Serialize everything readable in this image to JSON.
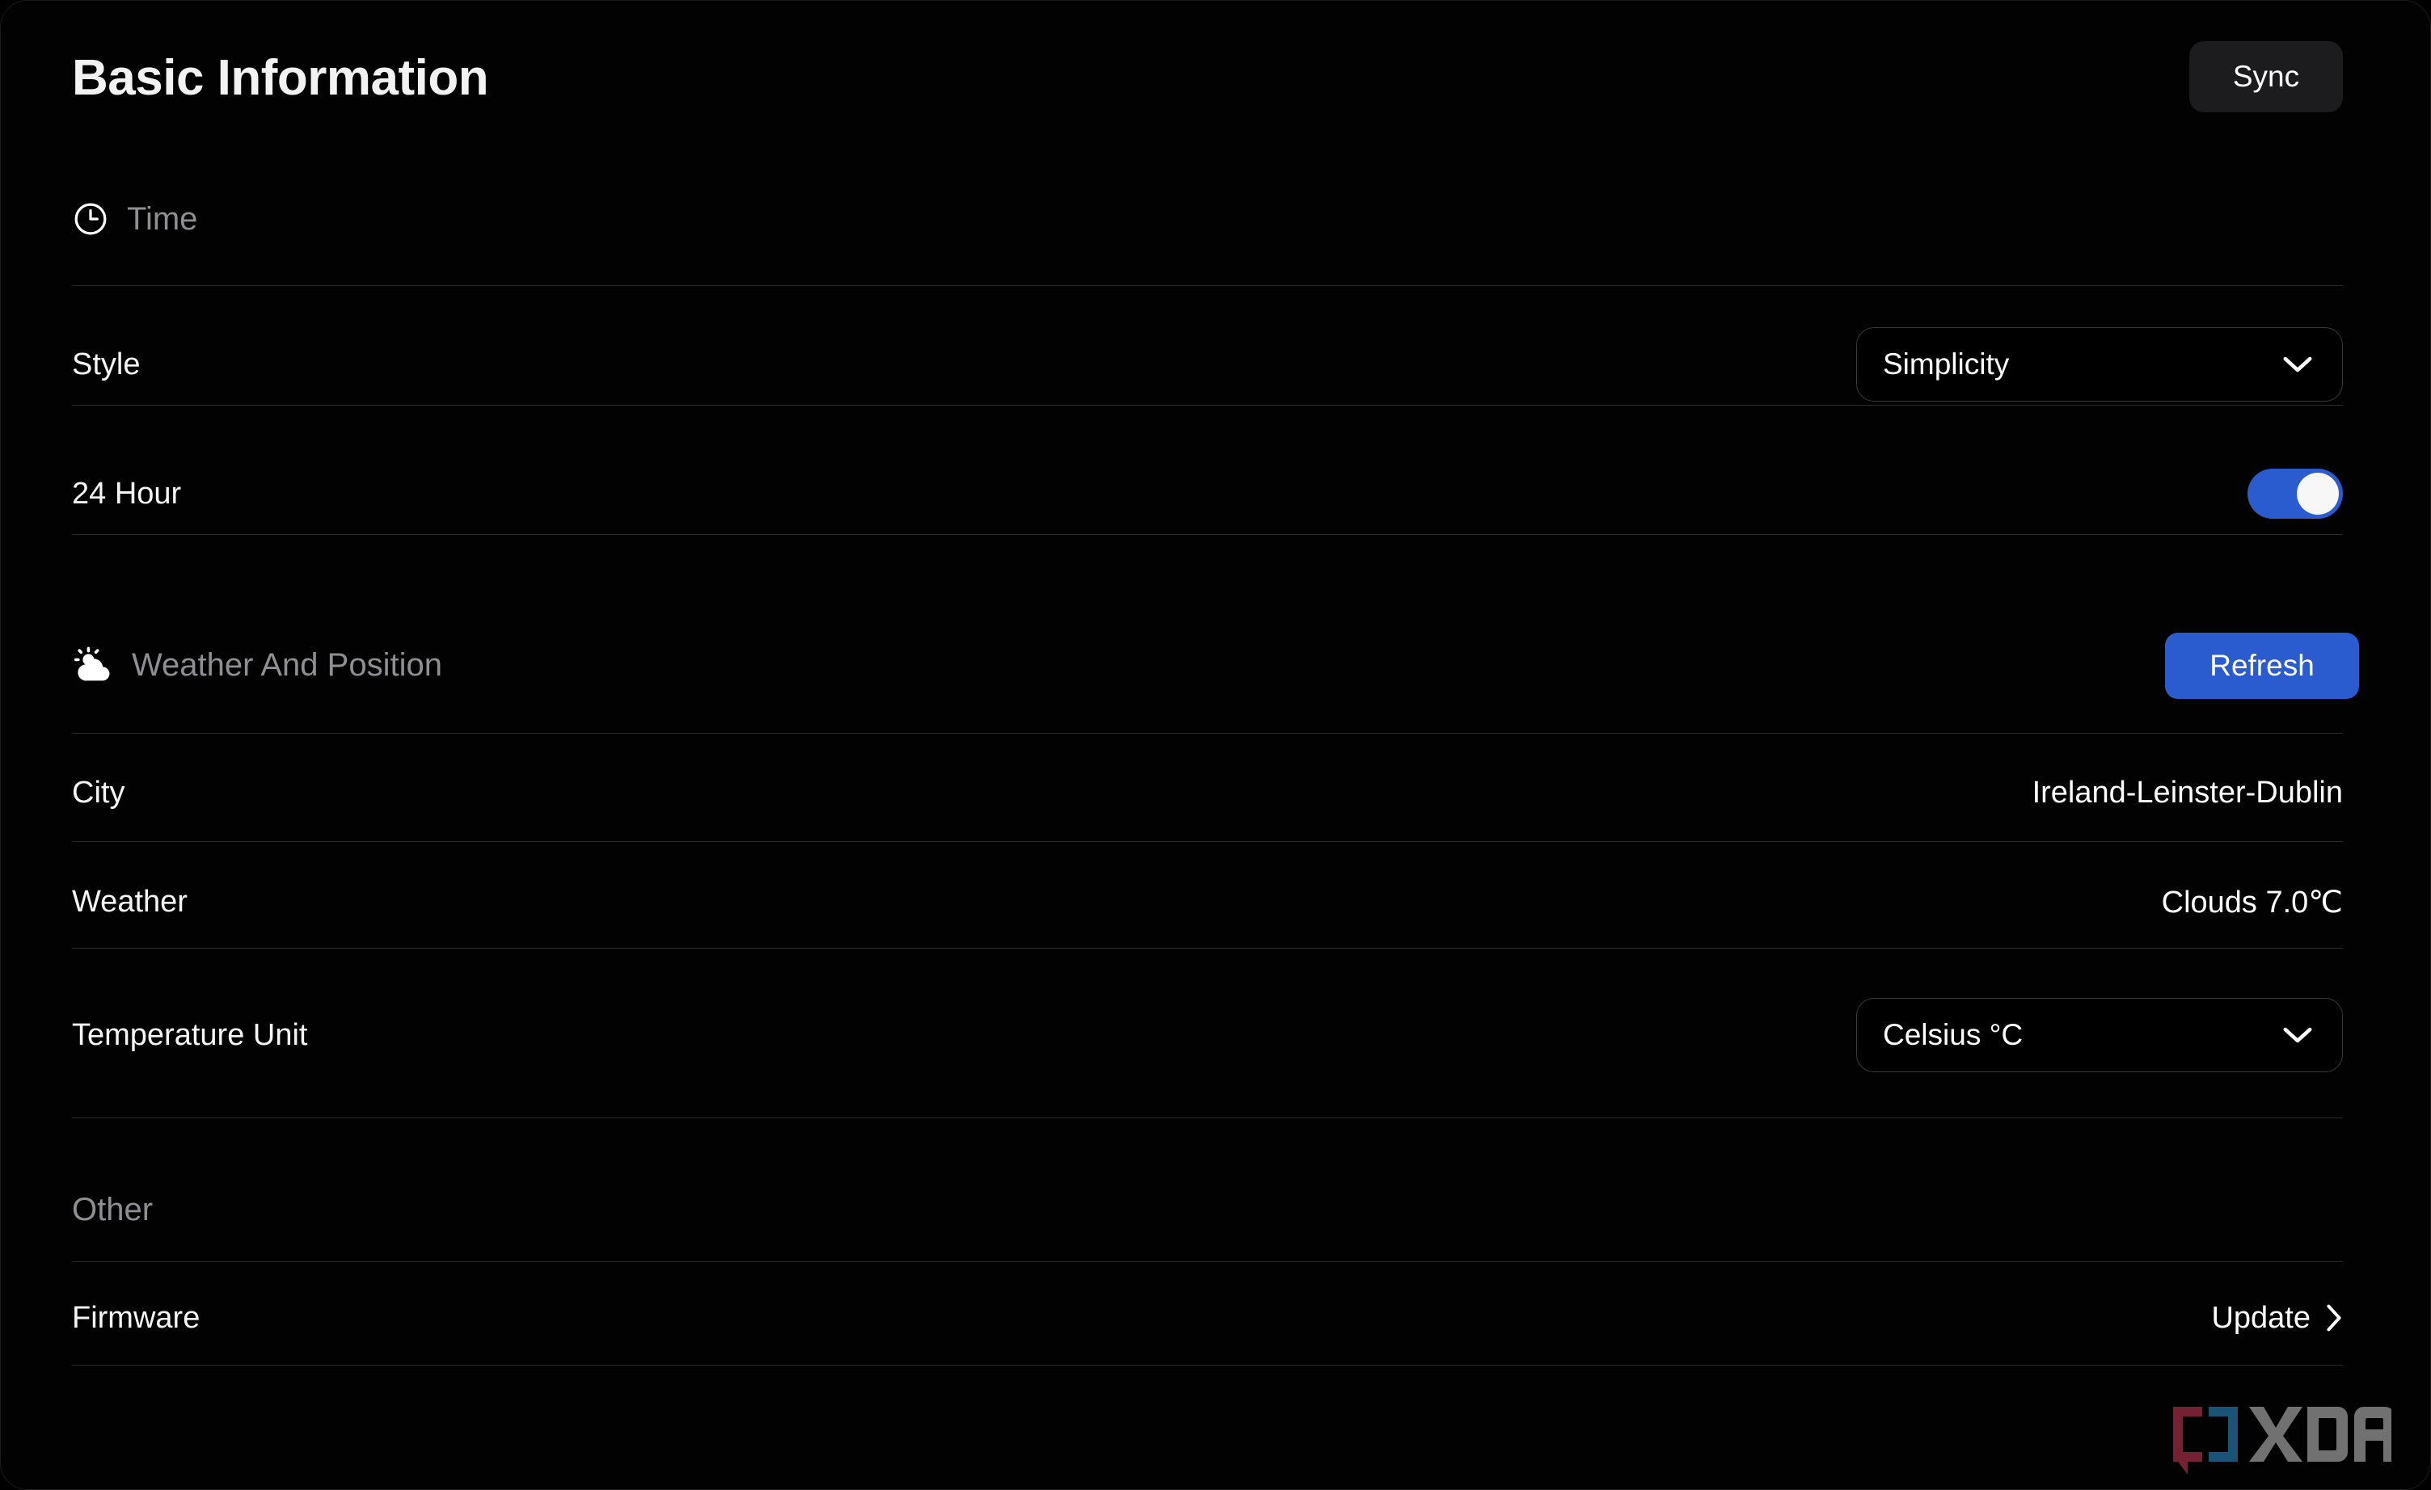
{
  "header": {
    "title": "Basic Information",
    "sync_label": "Sync"
  },
  "sections": {
    "time": {
      "label": "Time",
      "icon": "clock-icon",
      "rows": [
        {
          "label": "Style",
          "type": "dropdown",
          "value": "Simplicity"
        },
        {
          "label": "24 Hour",
          "type": "toggle",
          "value": "on"
        }
      ]
    },
    "weather": {
      "label": "Weather And Position",
      "icon": "partly-cloudy-icon",
      "action_label": "Refresh",
      "rows": [
        {
          "label": "City",
          "type": "text",
          "value": "Ireland-Leinster-Dublin"
        },
        {
          "label": "Weather",
          "type": "text",
          "value": "Clouds 7.0℃"
        },
        {
          "label": "Temperature Unit",
          "type": "dropdown",
          "value": "Celsius °C"
        }
      ]
    },
    "other": {
      "label": "Other",
      "rows": [
        {
          "label": "Firmware",
          "type": "link",
          "value": "Update"
        }
      ]
    }
  },
  "watermark": {
    "text": "XDA"
  },
  "colors": {
    "background": "#020202",
    "accent_blue": "#2b5ccf",
    "sync_bg": "#1c1c1e",
    "text_primary": "#f5f5f5",
    "text_muted": "#8e8e93",
    "divider": "#2a2a2a",
    "watermark_red": "#8d2a3e",
    "watermark_blue": "#1f6791",
    "watermark_gray": "#8a8a8a"
  }
}
